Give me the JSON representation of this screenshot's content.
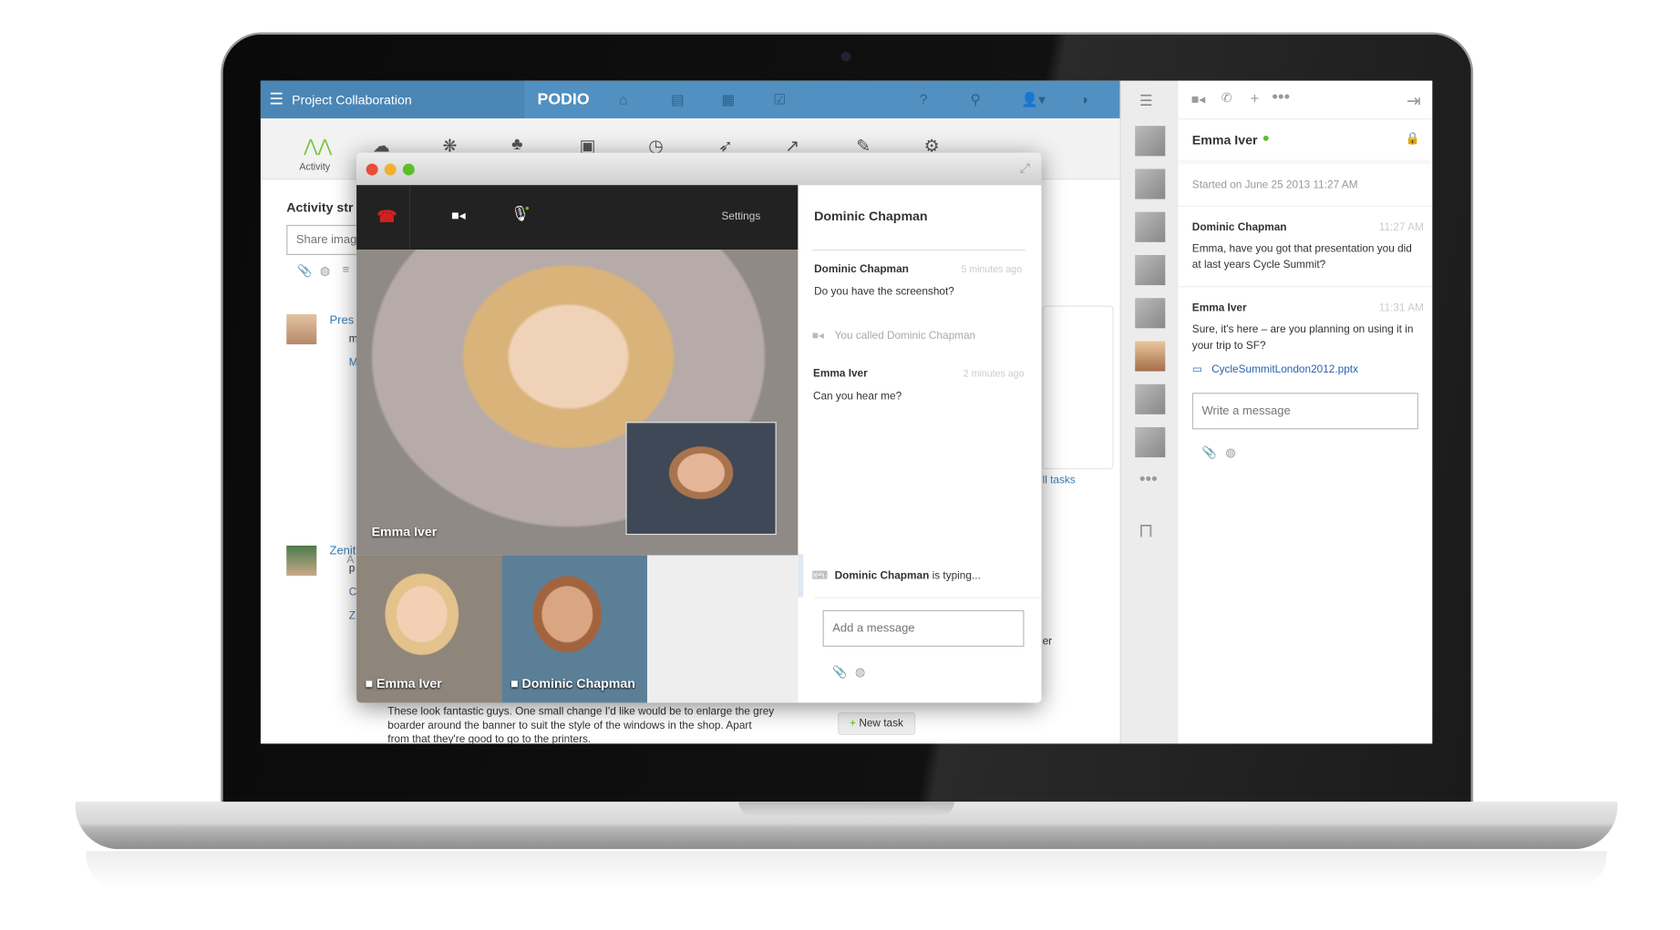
{
  "topbar": {
    "workspace": "Project Collaboration",
    "logo": "PODIO",
    "nav_icons": [
      "home-icon",
      "contacts-icon",
      "calendar-icon",
      "tasks-icon",
      "help-icon",
      "search-icon",
      "user-icon",
      "feed-icon"
    ]
  },
  "appbar": {
    "active": "Activity",
    "accent": "#7cc242",
    "icons": [
      "activity-icon",
      "cloud-icon",
      "brain-icon",
      "team-icon",
      "briefcase-icon",
      "clock-icon",
      "rocket-icon",
      "chart-icon",
      "brush-icon",
      "add-app-icon"
    ]
  },
  "activity": {
    "title": "Activity str",
    "share_placeholder": "Share image",
    "item1_title": "Pres",
    "item1_sub1": "m",
    "item1_sub2": "M",
    "item1_input": "A",
    "item2_title": "Zenit",
    "item2_sub1": "p",
    "item2_sub2": "C",
    "item2_sub3": "Z",
    "comment": "These look fantastic guys. One small change I'd like would be to enlarge the grey boarder around the banner to suit the style of the windows in the shop. Apart from that they're good to go to the printers.",
    "all_tasks": "ll tasks",
    "new_task": "New task",
    "partial_er": "er"
  },
  "call": {
    "settings": "Settings",
    "main_name": "Emma Iver",
    "thumbs": [
      "Emma Iver",
      "Dominic Chapman"
    ],
    "mic_active_color": "#5cbf2a",
    "hangup_color": "#d32020"
  },
  "call_chat": {
    "title": "Dominic Chapman",
    "messages": [
      {
        "author": "Dominic Chapman",
        "time": "5 minutes ago",
        "text": "Do you have the screenshot?"
      },
      {
        "author": "Emma Iver",
        "time": "2 minutes ago",
        "text": "Can you hear me?"
      }
    ],
    "event": "You called Dominic Chapman",
    "typing_name": "Dominic Chapman",
    "typing_suffix": "is typing...",
    "placeholder": "Add a message"
  },
  "chat": {
    "contact": "Emma Iver",
    "online_color": "#5cbf2a",
    "started": "Started on June 25 2013 11:27 AM",
    "messages": [
      {
        "author": "Dominic Chapman",
        "time": "11:27 AM",
        "text": "Emma, have you got that presentation you did at last years Cycle Summit?"
      },
      {
        "author": "Emma Iver",
        "time": "11:31 AM",
        "text": "Sure, it's here – are you planning on using it in your trip to SF?",
        "attachment": "CycleSummitLondon2012.pptx"
      }
    ],
    "placeholder": "Write a message"
  }
}
